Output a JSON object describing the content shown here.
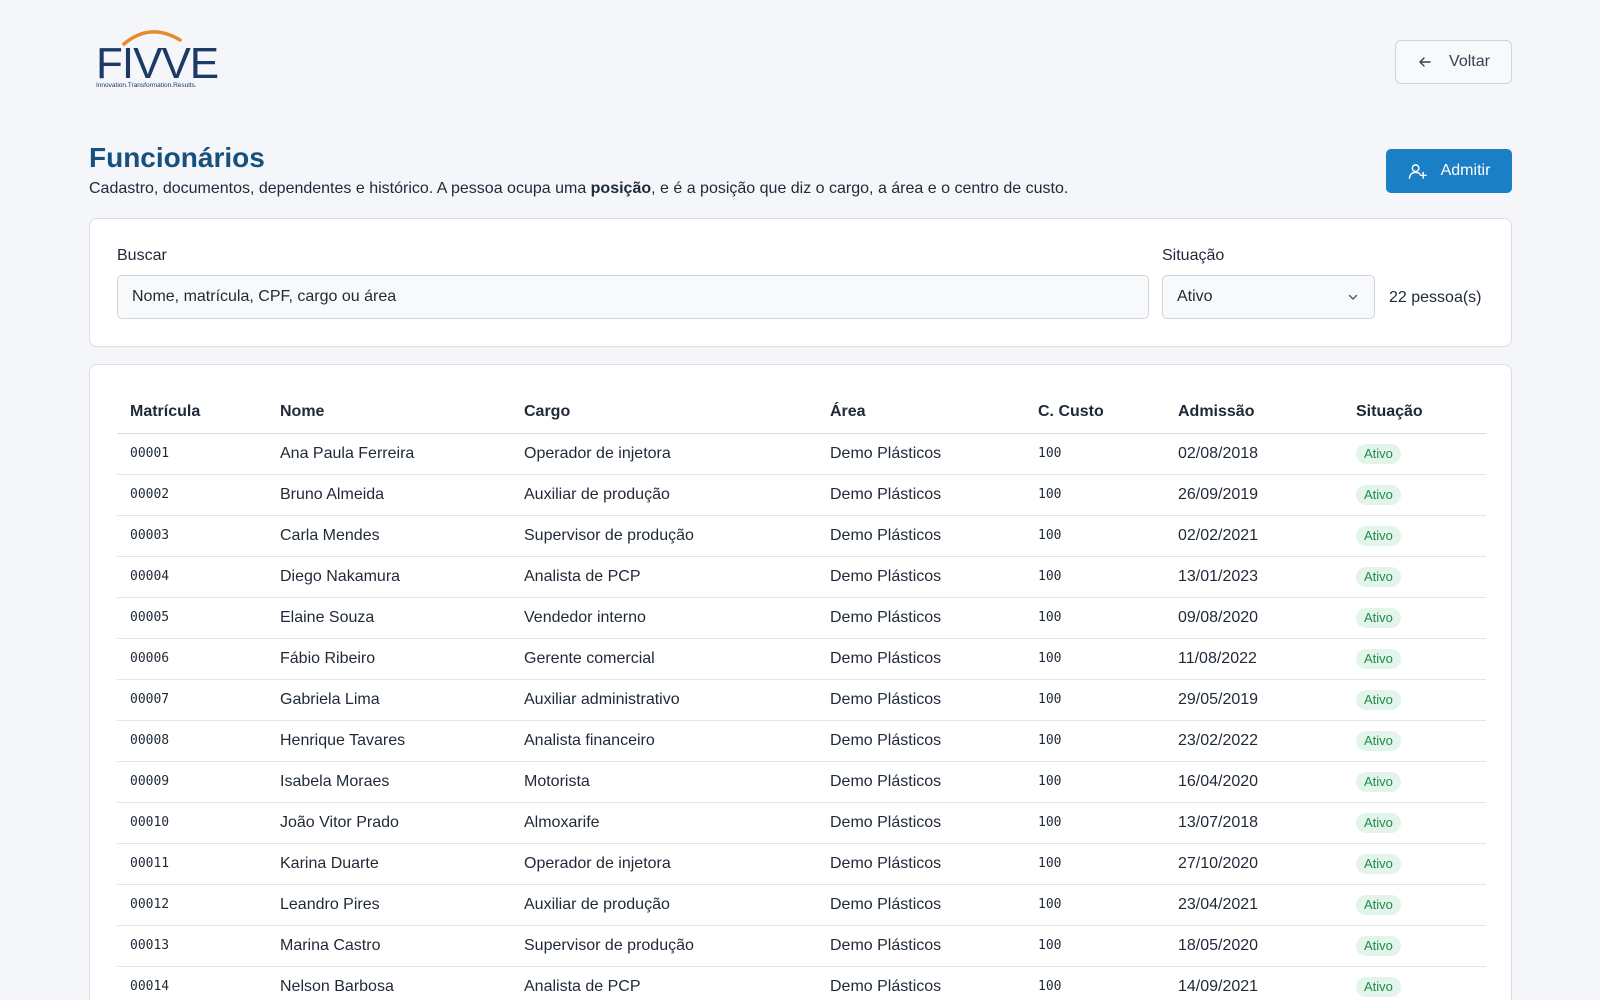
{
  "brand": {
    "logo_text": "FIVVE",
    "tagline": "Innovation.Transformation.Results.",
    "arc_color": "#e8892a",
    "text_color": "#1b3a66"
  },
  "header": {
    "back_label": "Voltar"
  },
  "page": {
    "title": "Funcionários",
    "subtitle_pre": "Cadastro, documentos, dependentes e histórico. A pessoa ocupa uma ",
    "subtitle_bold": "posição",
    "subtitle_post": ", e é a posição que diz o cargo, a área e o centro de custo.",
    "admit_label": "Admitir"
  },
  "filters": {
    "search_label": "Buscar",
    "search_placeholder": "Nome, matrícula, CPF, cargo ou área",
    "status_label": "Situação",
    "status_value": "Ativo",
    "count_text": "22 pessoa(s)"
  },
  "table": {
    "columns": [
      "Matrícula",
      "Nome",
      "Cargo",
      "Área",
      "C. Custo",
      "Admissão",
      "Situação"
    ],
    "rows": [
      [
        "00001",
        "Ana Paula Ferreira",
        "Operador de injetora",
        "Demo Plásticos",
        "100",
        "02/08/2018",
        "Ativo"
      ],
      [
        "00002",
        "Bruno Almeida",
        "Auxiliar de produção",
        "Demo Plásticos",
        "100",
        "26/09/2019",
        "Ativo"
      ],
      [
        "00003",
        "Carla Mendes",
        "Supervisor de produção",
        "Demo Plásticos",
        "100",
        "02/02/2021",
        "Ativo"
      ],
      [
        "00004",
        "Diego Nakamura",
        "Analista de PCP",
        "Demo Plásticos",
        "100",
        "13/01/2023",
        "Ativo"
      ],
      [
        "00005",
        "Elaine Souza",
        "Vendedor interno",
        "Demo Plásticos",
        "100",
        "09/08/2020",
        "Ativo"
      ],
      [
        "00006",
        "Fábio Ribeiro",
        "Gerente comercial",
        "Demo Plásticos",
        "100",
        "11/08/2022",
        "Ativo"
      ],
      [
        "00007",
        "Gabriela Lima",
        "Auxiliar administrativo",
        "Demo Plásticos",
        "100",
        "29/05/2019",
        "Ativo"
      ],
      [
        "00008",
        "Henrique Tavares",
        "Analista financeiro",
        "Demo Plásticos",
        "100",
        "23/02/2022",
        "Ativo"
      ],
      [
        "00009",
        "Isabela Moraes",
        "Motorista",
        "Demo Plásticos",
        "100",
        "16/04/2020",
        "Ativo"
      ],
      [
        "00010",
        "João Vitor Prado",
        "Almoxarife",
        "Demo Plásticos",
        "100",
        "13/07/2018",
        "Ativo"
      ],
      [
        "00011",
        "Karina Duarte",
        "Operador de injetora",
        "Demo Plásticos",
        "100",
        "27/10/2020",
        "Ativo"
      ],
      [
        "00012",
        "Leandro Pires",
        "Auxiliar de produção",
        "Demo Plásticos",
        "100",
        "23/04/2021",
        "Ativo"
      ],
      [
        "00013",
        "Marina Castro",
        "Supervisor de produção",
        "Demo Plásticos",
        "100",
        "18/05/2020",
        "Ativo"
      ],
      [
        "00014",
        "Nelson Barbosa",
        "Analista de PCP",
        "Demo Plásticos",
        "100",
        "14/09/2021",
        "Ativo"
      ]
    ]
  },
  "colors": {
    "title": "#16507e",
    "primary_button": "#1a7fc4",
    "badge_bg": "#e3f5ea",
    "badge_text": "#1f8a4c"
  },
  "icons": {
    "back": "arrow-left-icon",
    "admit": "user-plus-icon",
    "select": "chevron-down-icon"
  }
}
